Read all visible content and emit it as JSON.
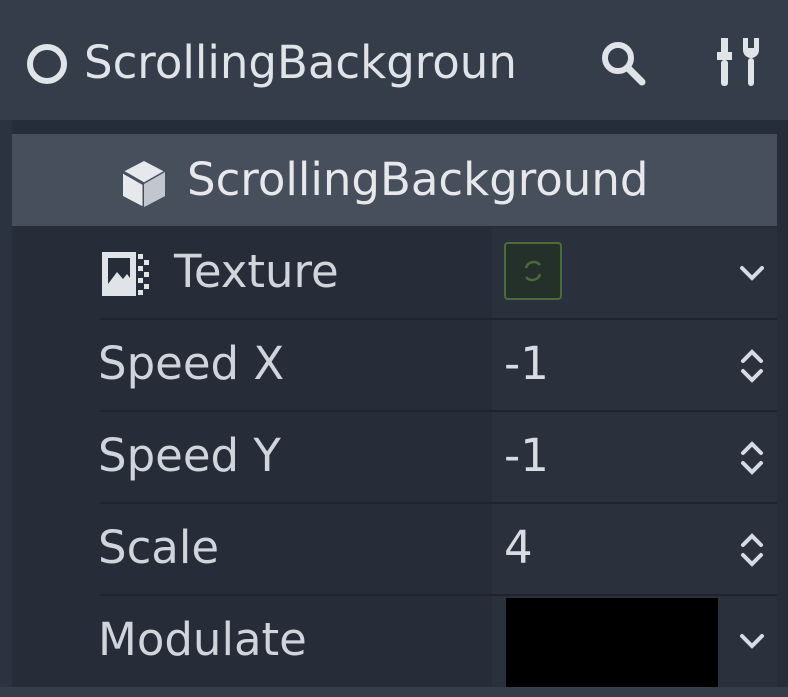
{
  "header": {
    "node_name": "ScrollingBackgroun",
    "search_icon": "search-icon",
    "tools_icon": "tools-icon"
  },
  "inspector": {
    "section_title": "ScrollingBackground",
    "properties": [
      {
        "label": "Texture",
        "value": "",
        "control": "texture-picker"
      },
      {
        "label": "Speed X",
        "value": "-1",
        "control": "spin-box"
      },
      {
        "label": "Speed Y",
        "value": "-1",
        "control": "spin-box"
      },
      {
        "label": "Scale",
        "value": "4",
        "control": "spin-box"
      },
      {
        "label": "Modulate",
        "value": "",
        "control": "color-picker",
        "color": "#000000"
      }
    ]
  },
  "colors": {
    "header_bg": "#363d4a",
    "panel_bg": "#262c38",
    "section_bg": "#474e5c",
    "texture_border": "#4b6b38"
  }
}
